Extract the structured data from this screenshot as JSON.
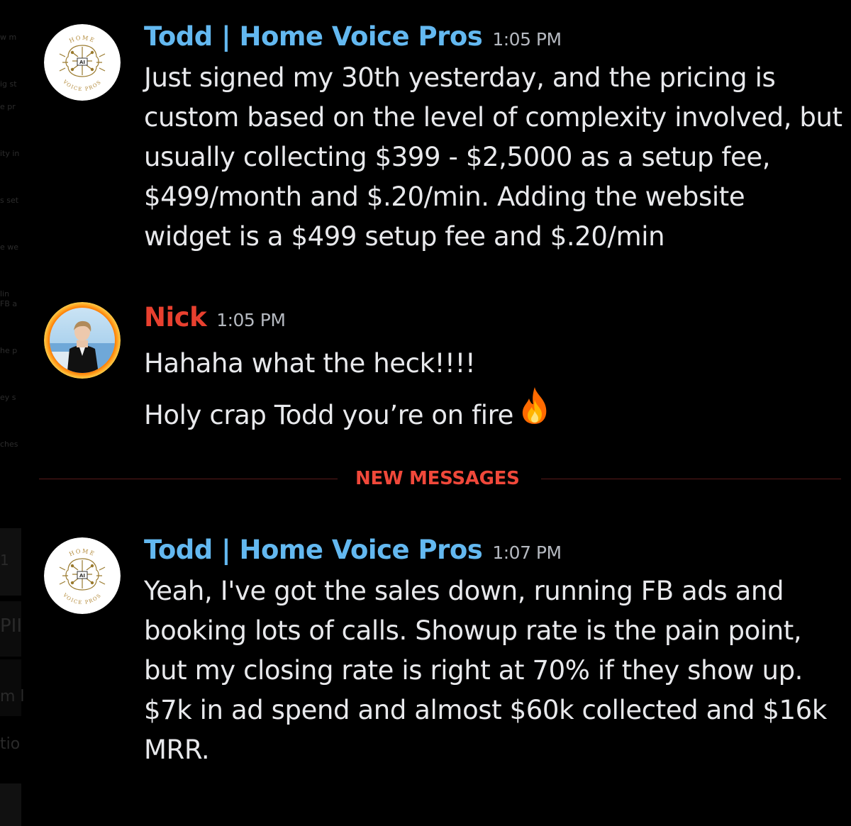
{
  "colors": {
    "background": "#000000",
    "todd_name": "#63b8f0",
    "nick_name": "#e8402f",
    "message_text": "#e8e9ec",
    "timestamp": "#b5b9c0",
    "new_messages": "#f0483a",
    "divider": "#5a1a1a"
  },
  "messages": [
    {
      "author": "Todd | Home Voice Pros",
      "time": "1:05 PM",
      "avatar": "home-voice-pros-logo",
      "lines": [
        "Just signed my 30th yesterday, and the pricing is",
        "custom based on the level of complexity involved, but",
        "usually collecting $399 - $2,5000 as a setup fee,",
        "$499/month and $.20/min.  Adding the website",
        "widget is a $499 setup fee and $.20/min"
      ]
    },
    {
      "author": "Nick",
      "time": "1:05 PM",
      "avatar": "nick-profile-photo",
      "lines": [
        "Hahaha what the heck!!!!",
        "Holy crap Todd you’re on fire"
      ],
      "emoji": "fire-icon"
    },
    {
      "author": "Todd | Home Voice Pros",
      "time": "1:07 PM",
      "avatar": "home-voice-pros-logo",
      "lines": [
        "Yeah, I've got the sales down, running FB ads and",
        "booking lots of calls.  Showup rate is the pain point,",
        "but my closing rate is right at 70% if they show up.",
        "$7k in ad spend and almost $60k collected and $16k",
        "MRR."
      ]
    }
  ],
  "divider": {
    "label": "NEW MESSAGES"
  },
  "logo": {
    "top_text": "HOME",
    "bottom_text": "VOICE PROS",
    "center_text": "AI"
  },
  "left_strip": {
    "top_lines": [
      "w m",
      "ig st"
    ],
    "mid_lines": [
      "e pr",
      "ity in",
      "s set",
      "e we",
      "lin"
    ],
    "mid2_lines": [
      "FB a",
      "he p",
      "ey s",
      "ches"
    ],
    "pill_text": "PII",
    "m_text": "m l",
    "tio_text": "tio",
    "one_text": "1"
  }
}
